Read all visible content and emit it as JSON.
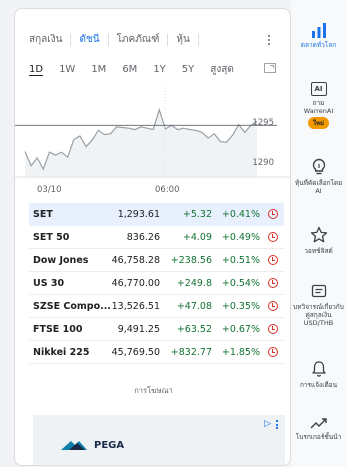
{
  "tabs": [
    "สกุลเงิน",
    "ดัชนี",
    "โภคภัณฑ์",
    "หุ้น"
  ],
  "active_tab": 1,
  "ranges": [
    "1D",
    "1W",
    "1M",
    "6M",
    "1Y",
    "5Y",
    "สูงสุด"
  ],
  "active_range": 0,
  "chart_data": {
    "type": "line",
    "x_labels": [
      "03/10",
      "06:00"
    ],
    "y_labels": [
      "1295",
      "1290"
    ],
    "ylim": [
      1287,
      1300
    ],
    "reference_value": 1294.3,
    "values": [
      1290.6,
      1288.6,
      1289.7,
      1288.1,
      1290.5,
      1290.1,
      1290.5,
      1289.8,
      1292.3,
      1292.8,
      1291.3,
      1292.2,
      1293.6,
      1293.0,
      1293.1,
      1294.1,
      1294.0,
      1293.9,
      1293.7,
      1294.1,
      1293.9,
      1293.7,
      1296.5,
      1293.8,
      1294.3,
      1293.7,
      1293.9,
      1293.7,
      1293.6,
      1293.3,
      1292.5,
      1293.1,
      1292.0,
      1291.9,
      1292.9,
      1294.4,
      1293.3,
      1294.3,
      1294.9
    ],
    "colors": {
      "line": "#9aa0a6",
      "fill": "#e8eaed",
      "reference": "#5f6368"
    }
  },
  "table": [
    {
      "name": "SET",
      "price": "1,293.61",
      "change": "+5.32",
      "pct": "+0.41%"
    },
    {
      "name": "SET 50",
      "price": "836.26",
      "change": "+4.09",
      "pct": "+0.49%"
    },
    {
      "name": "Dow Jones",
      "price": "46,758.28",
      "change": "+238.56",
      "pct": "+0.51%"
    },
    {
      "name": "US 30",
      "price": "46,770.00",
      "change": "+249.8",
      "pct": "+0.54%"
    },
    {
      "name": "SZSE Compo...",
      "price": "13,526.51",
      "change": "+47.08",
      "pct": "+0.35%"
    },
    {
      "name": "FTSE 100",
      "price": "9,491.25",
      "change": "+63.52",
      "pct": "+0.67%"
    },
    {
      "name": "Nikkei 225",
      "price": "45,769.50",
      "change": "+832.77",
      "pct": "+1.85%"
    }
  ],
  "ad": {
    "label": "การโฆษณา",
    "brand": "PEGA"
  },
  "rail": {
    "markets": "ตลาดทั่วโลก",
    "warren": "ถาม WarrenAI",
    "warren_badge": "ใหม่",
    "ai_picks": "หุ้นที่คัดเลือกโดย AI",
    "watchlist": "วอทช์ลิสต์",
    "converter": "บทวิจารณ์เกี่ยวกับคู่สกุลเงิน USD/THB",
    "alerts": "การแจ้งเตือน",
    "top": "โบรกเกอร์ชั้นนำ"
  }
}
